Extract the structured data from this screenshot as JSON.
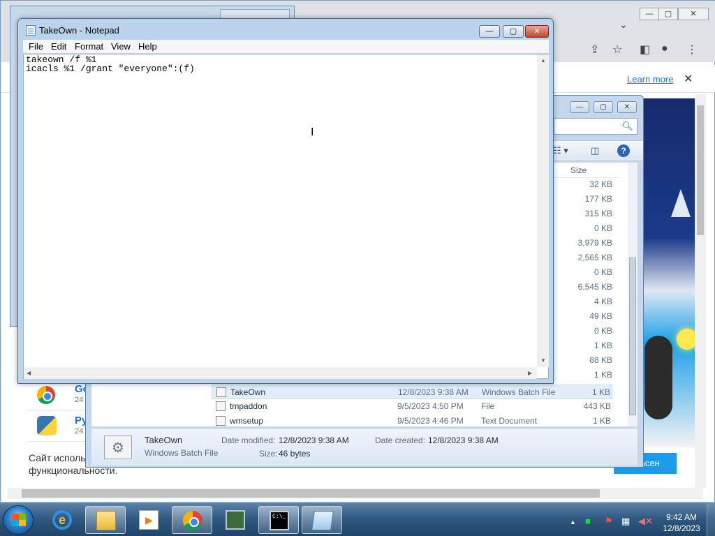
{
  "browser": {
    "learn_more": "Learn more",
    "close_symbol": "✕",
    "tab_dropdown": "⌄",
    "list_rows": [
      {
        "title": "Go",
        "sub": "24"
      },
      {
        "title": "Py",
        "sub": "24"
      }
    ],
    "cookie_text_1": "Сайт исполь",
    "cookie_text_2": "функциональности.",
    "cookie_button": "ласен"
  },
  "explorer": {
    "column_header": "Size",
    "sizes_above": [
      "32 KB",
      "177 KB",
      "315 KB",
      "0 KB",
      "3,979 KB",
      "2,565 KB",
      "0 KB",
      "6,545 KB",
      "4 KB",
      "49 KB",
      "0 KB",
      "1 KB",
      "88 KB",
      "1 KB"
    ],
    "files": [
      {
        "name": "TakeOwn",
        "date": "12/8/2023 9:38 AM",
        "type": "Windows Batch File",
        "size": "1 KB",
        "selected": true
      },
      {
        "name": "tmpaddon",
        "date": "9/5/2023 4:50 PM",
        "type": "File",
        "size": "443 KB",
        "selected": false
      },
      {
        "name": "wmsetup",
        "date": "9/5/2023 4:46 PM",
        "type": "Text Document",
        "size": "1 KB",
        "selected": false
      }
    ],
    "details": {
      "name": "TakeOwn",
      "type": "Windows Batch File",
      "date_modified_label": "Date modified:",
      "date_modified": "12/8/2023 9:38 AM",
      "date_created_label": "Date created:",
      "date_created": "12/8/2023 9:38 AM",
      "size_label": "Size:",
      "size": "46 bytes"
    }
  },
  "notepad": {
    "title": "TakeOwn - Notepad",
    "menu": [
      "File",
      "Edit",
      "Format",
      "View",
      "Help"
    ],
    "lines": [
      "takeown /f %1",
      "icacls %1 /grant \"everyone\":(f)"
    ]
  },
  "taskbar": {
    "time": "9:42 AM",
    "date": "12/8/2023",
    "cmd_text": "C:\\_"
  }
}
